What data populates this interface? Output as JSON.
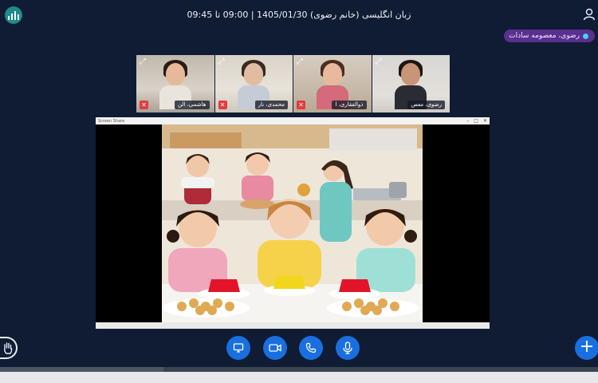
{
  "header": {
    "title": "زبان انگلیسی (خانم رضوی) 1405/01/30 | 09:00 تا 09:45",
    "presenter": "رضوی، معصومه سادات"
  },
  "participants": [
    {
      "name": "هاشمی، الن",
      "camera_off": true,
      "active": false
    },
    {
      "name": "محمدی، نار",
      "camera_off": true,
      "active": false
    },
    {
      "name": "ذوالفقاری، ا",
      "camera_off": true,
      "active": false
    },
    {
      "name": "رضوی، معص",
      "camera_off": false,
      "active": true
    }
  ],
  "shared_window": {
    "title": "Screen Share"
  },
  "controls": {
    "screen_share": "screen-share-icon",
    "camera": "camera-icon",
    "phone": "phone-icon",
    "microphone": "microphone-icon",
    "raise_hand": "hand-icon",
    "add": "+"
  },
  "colors": {
    "background": "#0f1c33",
    "accent": "#1a6fe0",
    "presenter_badge": "#5a2f8f",
    "cam_off": "#e23c3c"
  }
}
